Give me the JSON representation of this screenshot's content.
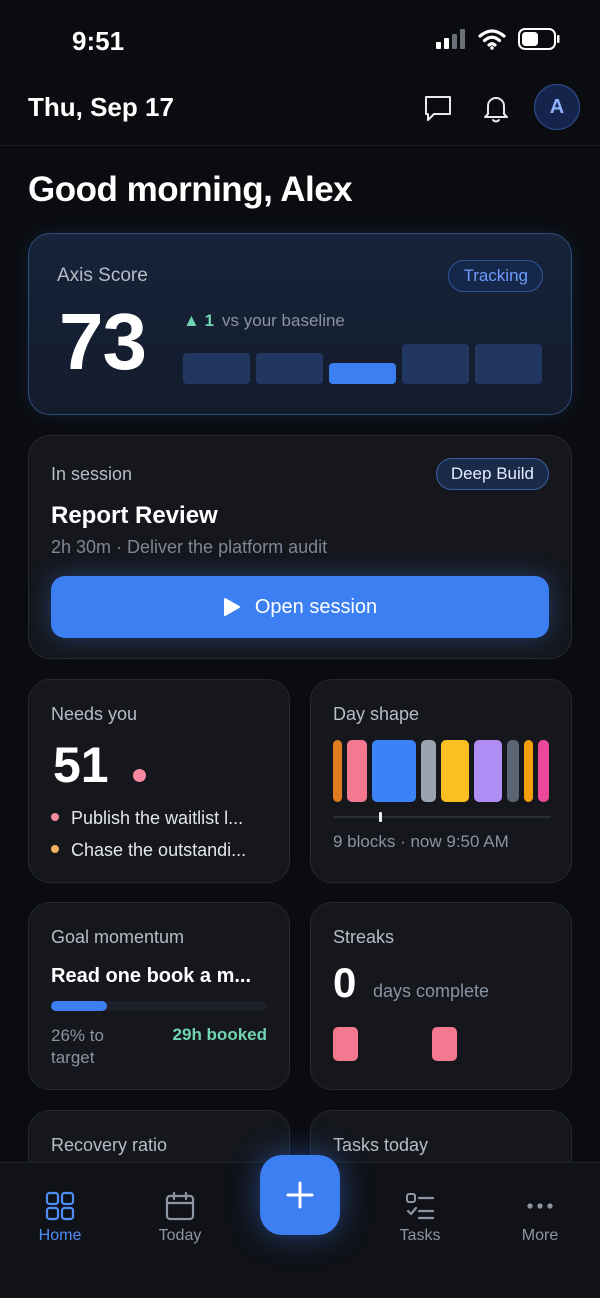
{
  "status_bar": {
    "time": "9:51"
  },
  "header": {
    "date": "Thu, Sep 17",
    "avatar_initial": "A"
  },
  "greeting": "Good morning, Alex",
  "axis": {
    "label": "Axis Score",
    "status": "Tracking",
    "score": "73",
    "delta": "1",
    "delta_text": "vs your baseline"
  },
  "session": {
    "label": "In session",
    "badge": "Deep Build",
    "title": "Report Review",
    "subtitle": "2h 30m · Deliver the platform audit",
    "button_label": "Open session"
  },
  "needs": {
    "title": "Needs you",
    "count": "51",
    "items": [
      {
        "label": "Publish the waitlist l...",
        "color": "#f58aa0"
      },
      {
        "label": "Chase the outstandi...",
        "color": "#f2b35a"
      }
    ]
  },
  "day_shape": {
    "title": "Day shape",
    "meta": "9 blocks · now 9:50 AM",
    "block_colors": [
      "#e07b1f",
      "#f4788f",
      "#3b82f6",
      "#9aa3b0",
      "#fbbf24",
      "#b08cf5",
      "#5b6473",
      "#f59e0b",
      "#ec4899"
    ]
  },
  "goal": {
    "title": "Goal momentum",
    "name": "Read one book a m...",
    "progress": 0.26,
    "pct_text": "26% to target",
    "booked": "29h booked"
  },
  "streaks": {
    "title": "Streaks",
    "count": "0",
    "label": "days complete",
    "days": [
      true,
      false,
      false,
      true,
      false,
      false,
      false
    ]
  },
  "cards_bottom": {
    "recovery_title": "Recovery ratio",
    "tasks_title": "Tasks today"
  },
  "nav": {
    "home": "Home",
    "today": "Today",
    "tasks": "Tasks",
    "more": "More"
  },
  "colors": {
    "accent": "#3b7ff2",
    "positive": "#6fd3b0"
  }
}
